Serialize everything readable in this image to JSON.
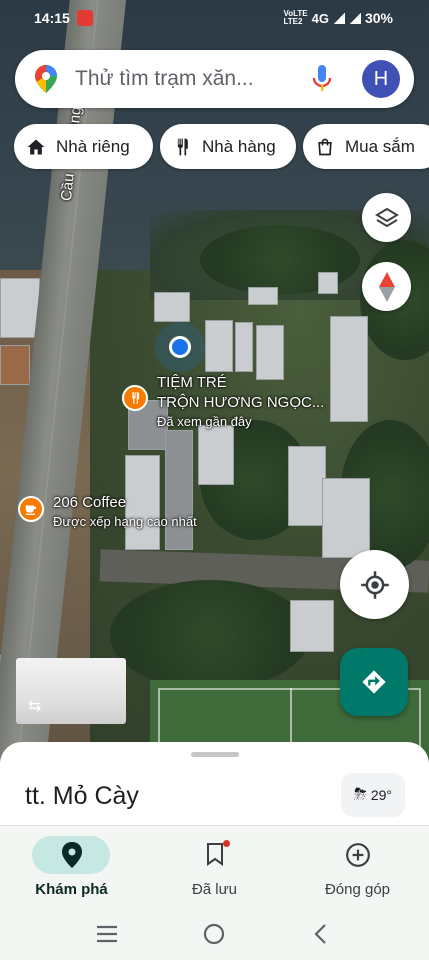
{
  "status_bar": {
    "time": "14:15",
    "network": "4G",
    "battery": "30%"
  },
  "search": {
    "placeholder": "Thử tìm trạm xăn...",
    "avatar_letter": "H"
  },
  "chips": [
    {
      "label": "Nhà riêng",
      "icon": "home-icon"
    },
    {
      "label": "Nhà hàng",
      "icon": "restaurant-icon"
    },
    {
      "label": "Mua sắm",
      "icon": "shopping-bag-icon"
    }
  ],
  "map": {
    "road_label": "Cầu 17 Tháng",
    "pois": [
      {
        "name_line1": "TIỆM TRÉ",
        "name_line2": "TRỘN HƯƠNG NGỌC...",
        "subtitle": "Đã xem gần đây",
        "icon": "restaurant-icon"
      },
      {
        "name_line1": "206 Coffee",
        "subtitle": "Được xếp hạng cao nhất",
        "icon": "coffee-icon"
      }
    ]
  },
  "sheet": {
    "title": "tt. Mỏ Cày",
    "temperature": "29°"
  },
  "nav": {
    "items": [
      {
        "label": "Khám phá",
        "icon": "explore-pin-icon",
        "active": true
      },
      {
        "label": "Đã lưu",
        "icon": "bookmark-icon",
        "active": false
      },
      {
        "label": "Đóng góp",
        "icon": "add-circle-icon",
        "active": false
      }
    ]
  },
  "colors": {
    "accent": "#00796b",
    "nav_active_pill": "#c5e8e2",
    "avatar": "#3f51b5",
    "poi": "#f57c00"
  }
}
